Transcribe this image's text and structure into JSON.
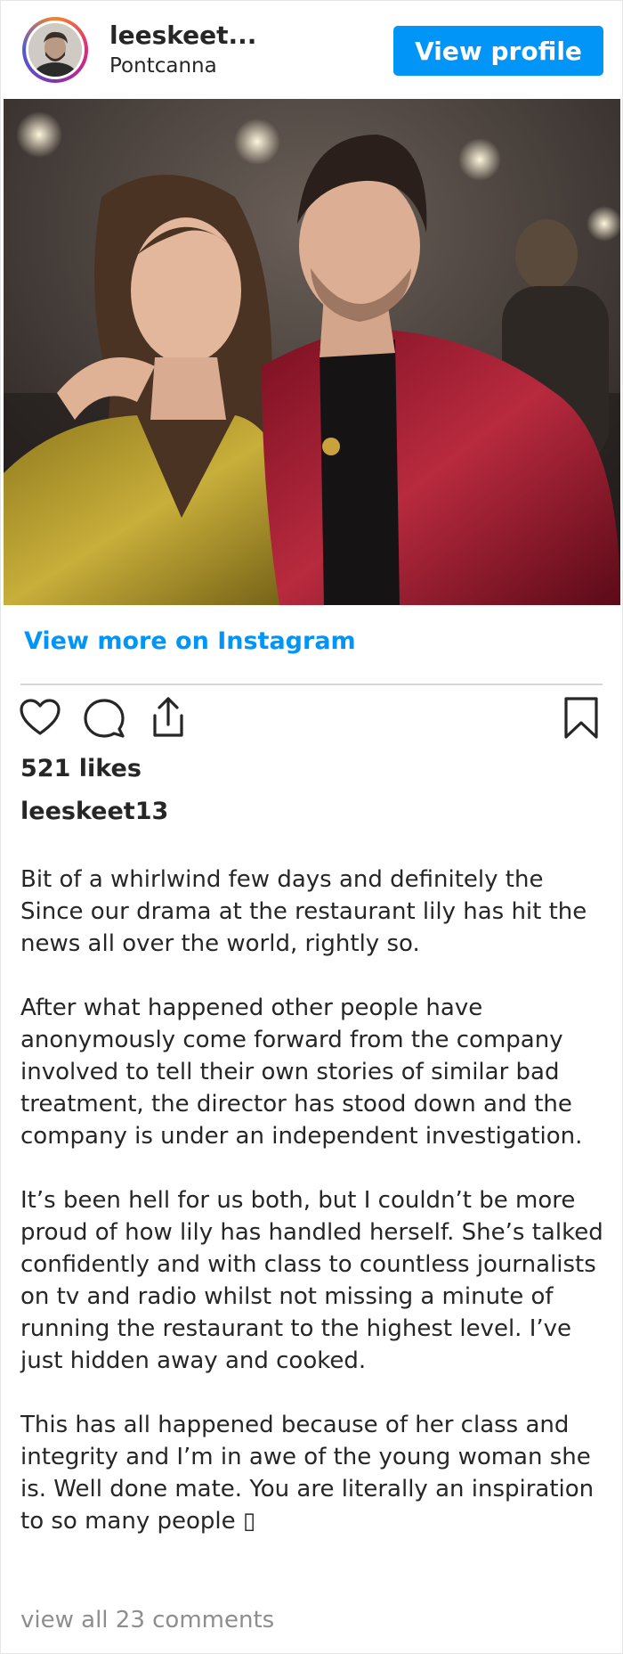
{
  "header": {
    "username": "leeskeet...",
    "location": "Pontcanna",
    "view_profile_label": "View profile"
  },
  "links": {
    "view_more_label": "View more on Instagram"
  },
  "post": {
    "likes": "521 likes",
    "caption_username": "leeskeet13",
    "caption": "Bit of a whirlwind few days and definitely the Since our drama at the restaurant lily has hit the news all over the world, rightly so.\n\nAfter what happened other people have anonymously come forward from the company involved to tell their own stories of similar bad treatment, the director has stood down and the company is under an independent investigation.\n\nIt’s been hell for us both, but I couldn’t be more proud of how lily has handled herself. She’s talked confidently and with class to countless journalists on tv and radio whilst not missing a minute of running the restaurant to the highest level. I’ve just hidden away and cooked.\n\nThis has all happened because of her class and integrity and I’m in awe of the young woman she is. Well done mate. You are literally an inspiration to so many people ▯",
    "view_comments_label": "view all 23 comments"
  },
  "icons": {
    "like": "heart-icon",
    "comment": "comment-icon",
    "share": "share-icon",
    "save": "bookmark-icon"
  },
  "colors": {
    "brand_blue": "#0095f6",
    "text": "#262626",
    "muted": "#8e8e8e"
  }
}
